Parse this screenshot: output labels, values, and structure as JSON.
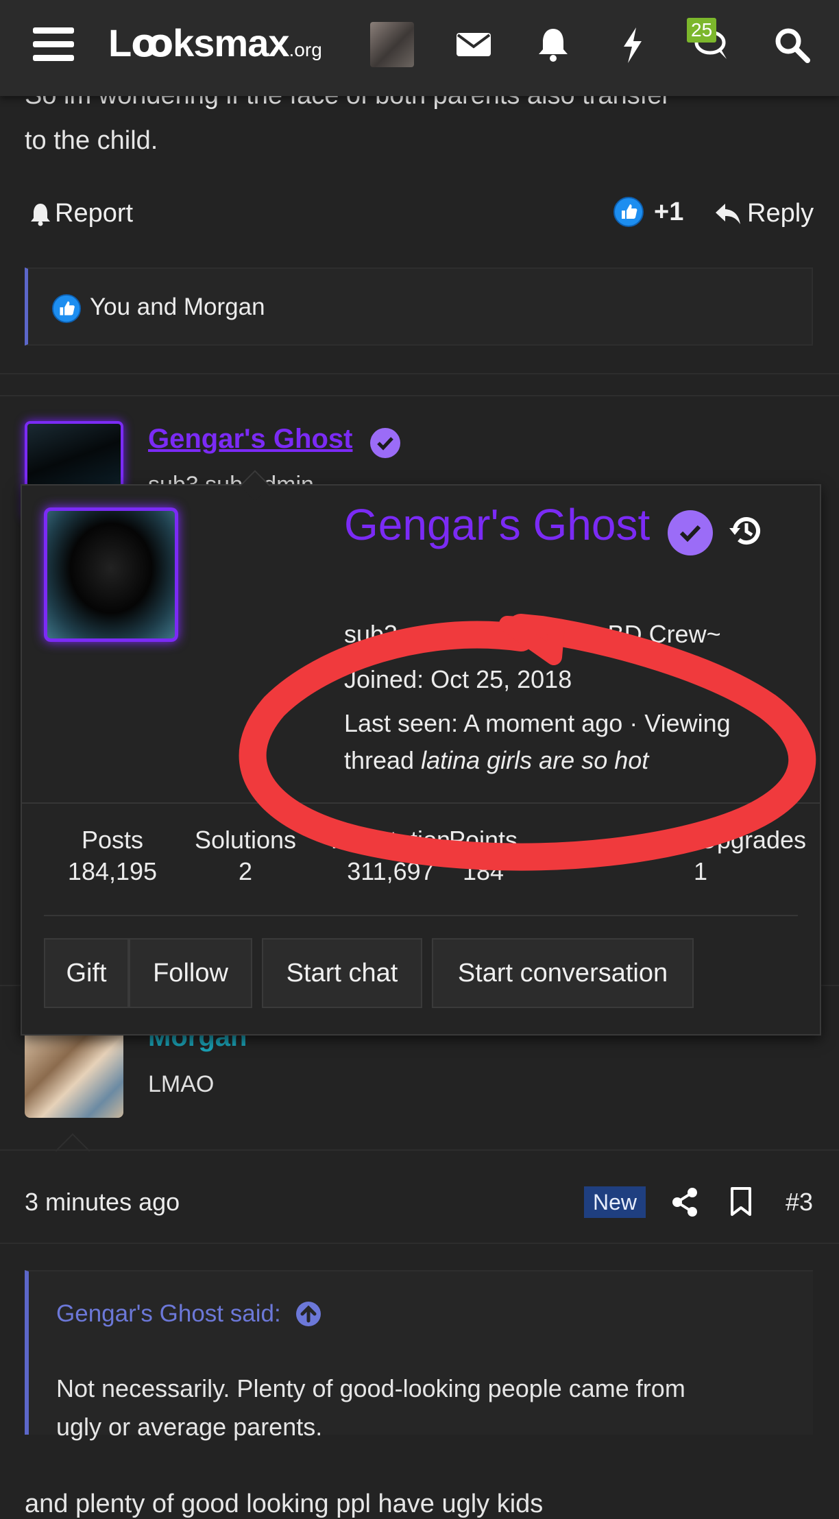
{
  "topbar": {
    "site_name": "Lꝏksmax",
    "site_tld": ".org",
    "alerts_badge": "25"
  },
  "prev_post": {
    "text_line1": "So im wondering if the face of both parents also transfer",
    "text_line2": "to the child.",
    "report_label": "Report",
    "reaction_count": "+1",
    "reply_label": "Reply",
    "likes_text": "You and Morgan"
  },
  "post2": {
    "author_name": "Gengar's Ghost",
    "author_sub_partial": "sub3 sub-admin"
  },
  "member_card": {
    "name": "Gengar's Ghost",
    "title": "sub3 sub-admin Team ~BD Crew~",
    "joined": "Joined: Oct 25, 2018",
    "last_seen_prefix": "Last seen: A moment ago · Viewing",
    "last_seen_thread_word": "thread",
    "last_seen_thread_title": "latina girls are so hot",
    "stats": [
      {
        "label": "Posts",
        "value": "184,195"
      },
      {
        "label": "Solutions",
        "value": "2"
      },
      {
        "label": "Reputation",
        "value": "311,697"
      },
      {
        "label": "Points",
        "value": "184"
      },
      {
        "label": "Upgrades",
        "value": "1"
      }
    ],
    "buttons": {
      "gift": "Gift",
      "follow": "Follow",
      "start_chat": "Start chat",
      "start_conversation": "Start conversation"
    }
  },
  "post3": {
    "author_name": "Morgan",
    "author_title": "LMAO",
    "time": "3 minutes ago",
    "new_badge": "New",
    "post_number": "#3",
    "quote_author": "Gengar's Ghost said:",
    "quote_text_line1": "Not necessarily. Plenty of good-looking people came from",
    "quote_text_line2": "ugly or average parents.",
    "body_line1": "and plenty of good looking ppl have ugly kids"
  },
  "colors": {
    "username_purple": "#7b2bf5",
    "quote_accent": "#5c67c9",
    "annotation_red": "#f03a3d",
    "morgan_teal": "#1aa0b4"
  }
}
